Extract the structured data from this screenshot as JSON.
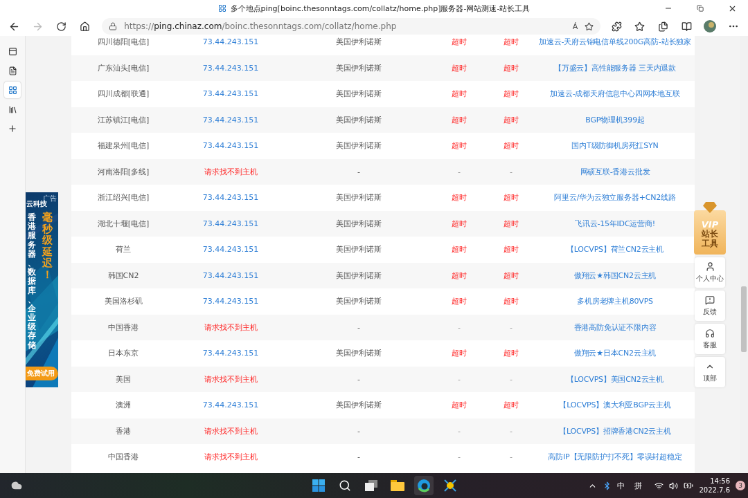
{
  "browser": {
    "title": "多个地点ping[boinc.thesonntags.com/collatz/home.php]服务器-网站测速-站长工具",
    "url_scheme": "https://",
    "url_host": "ping.chinaz.com",
    "url_path": "/boinc.thesonntags.com/collatz/home.php",
    "read_aloud": "Á"
  },
  "rail": [
    {
      "kind": "tabs",
      "selected": false
    },
    {
      "kind": "page",
      "selected": false
    },
    {
      "kind": "site",
      "selected": true
    },
    {
      "kind": "tools",
      "selected": false
    },
    {
      "kind": "add",
      "selected": false
    }
  ],
  "rows": [
    {
      "kind": "timeout",
      "location": "四川德阳[电信]",
      "ip": "73.44.243.151",
      "region": "美国伊利诺斯",
      "column_4": "超时",
      "column_5": "超时",
      "sponsor": "加速云-天府云锦电信单线200G高防-站长独家"
    },
    {
      "kind": "timeout",
      "location": "广东汕头[电信]",
      "ip": "73.44.243.151",
      "region": "美国伊利诺斯",
      "column_4": "超时",
      "column_5": "超时",
      "sponsor": "【万盛云】高性能服务器 三天内退款"
    },
    {
      "kind": "timeout",
      "location": "四川成都[联通]",
      "ip": "73.44.243.151",
      "region": "美国伊利诺斯",
      "column_4": "超时",
      "column_5": "超时",
      "sponsor": "加速云-成都天府信息中心四网本地互联"
    },
    {
      "kind": "timeout",
      "location": "江苏镇江[电信]",
      "ip": "73.44.243.151",
      "region": "美国伊利诺斯",
      "column_4": "超时",
      "column_5": "超时",
      "sponsor": "BGP物理机399起"
    },
    {
      "kind": "timeout",
      "location": "福建泉州[电信]",
      "ip": "73.44.243.151",
      "region": "美国伊利诺斯",
      "column_4": "超时",
      "column_5": "超时",
      "sponsor": "国内T级防御机房死扛SYN"
    },
    {
      "kind": "unreachable",
      "location": "河南洛阳[多线]",
      "ip": "请求找不到主机",
      "region": "-",
      "column_4": "-",
      "column_5": "-",
      "sponsor": "网硕互联-香港云批发"
    },
    {
      "kind": "timeout",
      "location": "浙江绍兴[电信]",
      "ip": "73.44.243.151",
      "region": "美国伊利诺斯",
      "column_4": "超时",
      "column_5": "超时",
      "sponsor": "阿里云/华为云独立服务器+CN2线路"
    },
    {
      "kind": "timeout",
      "location": "湖北十堰[电信]",
      "ip": "73.44.243.151",
      "region": "美国伊利诺斯",
      "column_4": "超时",
      "column_5": "超时",
      "sponsor": "飞讯云-15年IDC运营商!"
    },
    {
      "kind": "timeout",
      "location": "荷兰",
      "ip": "73.44.243.151",
      "region": "美国伊利诺斯",
      "column_4": "超时",
      "column_5": "超时",
      "sponsor": "【LOCVPS】荷兰CN2云主机"
    },
    {
      "kind": "timeout",
      "location": "韩国CN2",
      "ip": "73.44.243.151",
      "region": "美国伊利诺斯",
      "column_4": "超时",
      "column_5": "超时",
      "sponsor": "傲翔云★韩国CN2云主机"
    },
    {
      "kind": "timeout",
      "location": "美国洛杉矶",
      "ip": "73.44.243.151",
      "region": "美国伊利诺斯",
      "column_4": "超时",
      "column_5": "超时",
      "sponsor": "多机房老牌主机80VPS"
    },
    {
      "kind": "unreachable",
      "location": "中国香港",
      "ip": "请求找不到主机",
      "region": "-",
      "column_4": "-",
      "column_5": "-",
      "sponsor": "香港高防免认证不限内容"
    },
    {
      "kind": "timeout",
      "location": "日本东京",
      "ip": "73.44.243.151",
      "region": "美国伊利诺斯",
      "column_4": "超时",
      "column_5": "超时",
      "sponsor": "傲翔云★日本CN2云主机"
    },
    {
      "kind": "unreachable",
      "location": "美国",
      "ip": "请求找不到主机",
      "region": "-",
      "column_4": "-",
      "column_5": "-",
      "sponsor": "【LOCVPS】美国CN2云主机"
    },
    {
      "kind": "timeout",
      "location": "澳洲",
      "ip": "73.44.243.151",
      "region": "美国伊利诺斯",
      "column_4": "超时",
      "column_5": "超时",
      "sponsor": "【LOCVPS】澳大利亚BGP云主机"
    },
    {
      "kind": "unreachable",
      "location": "香港",
      "ip": "请求找不到主机",
      "region": "-",
      "column_4": "-",
      "column_5": "-",
      "sponsor": "【LOCVPS】招牌香港CN2云主机"
    },
    {
      "kind": "unreachable",
      "location": "中国香港",
      "ip": "请求找不到主机",
      "region": "-",
      "column_4": "-",
      "column_5": "-",
      "sponsor": "高防IP【无限防护打不死】零误封超稳定"
    }
  ],
  "ad": {
    "brand": "云科技",
    "tag": "广告",
    "headline": "毫秒级延迟！",
    "body": "香港服务器、数据库、企业级存储",
    "cta": "免费试用"
  },
  "float_panel": {
    "vip": "VIP",
    "vip_title": "站长工具",
    "buttons": [
      {
        "kind": "user",
        "label": "个人中心"
      },
      {
        "kind": "feedback",
        "label": "反馈"
      },
      {
        "kind": "service",
        "label": "客服"
      },
      {
        "kind": "top",
        "label": "顶部"
      }
    ]
  },
  "taskbar": {
    "ime_mode": "中",
    "ime": "拼",
    "time": "14:56",
    "date": "2022.7.6",
    "notifications": "3"
  }
}
